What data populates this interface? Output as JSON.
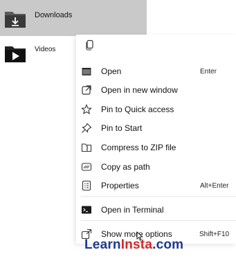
{
  "explorer": {
    "items": [
      {
        "label": "Downloads",
        "icon": "downloads-folder-icon",
        "selected": true
      },
      {
        "label": "Videos",
        "icon": "videos-folder-icon",
        "selected": false
      }
    ]
  },
  "menu": {
    "top_actions": [
      {
        "icon": "copy-icon"
      }
    ],
    "items": [
      {
        "label": "Open",
        "icon": "open-icon",
        "shortcut": "Enter"
      },
      {
        "label": "Open in new window",
        "icon": "new-window-icon",
        "shortcut": ""
      },
      {
        "label": "Pin to Quick access",
        "icon": "star-icon",
        "shortcut": ""
      },
      {
        "label": "Pin to Start",
        "icon": "pin-icon",
        "shortcut": ""
      },
      {
        "label": "Compress to ZIP file",
        "icon": "zip-icon",
        "shortcut": ""
      },
      {
        "label": "Copy as path",
        "icon": "copy-path-icon",
        "shortcut": ""
      },
      {
        "label": "Properties",
        "icon": "properties-icon",
        "shortcut": "Alt+Enter"
      },
      {
        "label": "Open in Terminal",
        "icon": "terminal-icon",
        "shortcut": ""
      },
      {
        "label": "Show more options",
        "icon": "more-options-icon",
        "shortcut": "Shift+F10"
      }
    ]
  },
  "watermark": {
    "part1": "Learn",
    "part2": "Insta",
    "part3": ".com"
  },
  "colors": {
    "selection": "#c9c9c9",
    "brand_blue": "#1f3b8a",
    "brand_red": "#d22a2a"
  }
}
